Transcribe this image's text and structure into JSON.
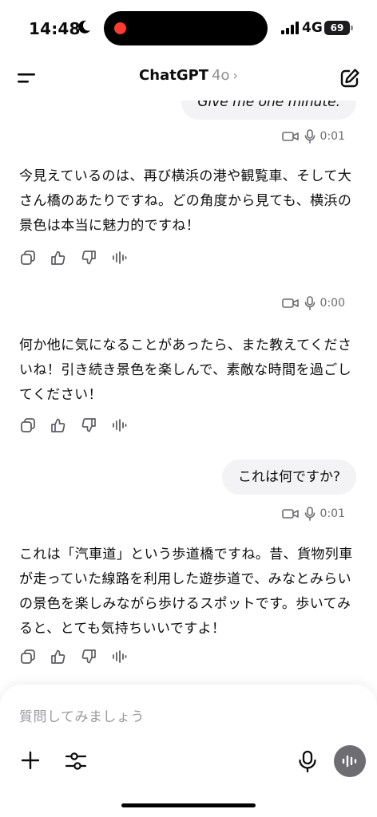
{
  "status_bar": {
    "time": "14:48",
    "network": "4G",
    "battery": "69",
    "icons": [
      "moon-icon",
      "signal-icon"
    ]
  },
  "header": {
    "title": "ChatGPT",
    "model": "4o",
    "icons": [
      "menu-icon",
      "chevron-right-icon",
      "compose-icon"
    ]
  },
  "messages": [
    {
      "role": "user",
      "text": "Give me one minute.",
      "duration": "0:01"
    },
    {
      "role": "assistant",
      "text": "今見えているのは、再び横浜の港や観覧車、そして大さん橋のあたりですね。どの角度から見ても、横浜の景色は本当に魅力的ですね！"
    },
    {
      "role": "user",
      "text": "",
      "duration": "0:00"
    },
    {
      "role": "assistant",
      "text": "何か他に気になることがあったら、また教えてくださいね！引き続き景色を楽しんで、素敵な時間を過ごしてください！"
    },
    {
      "role": "user",
      "text": "これは何ですか?",
      "duration": "0:01"
    },
    {
      "role": "assistant",
      "text": "これは「汽車道」という歩道橋ですね。昔、貨物列車が走っていた線路を利用した遊歩道で、みなとみらいの景色を楽しみながら歩けるスポットです。歩いてみると、とても気持ちいいですよ！"
    }
  ],
  "message_action_icons": [
    "copy-icon",
    "thumbs-up-icon",
    "thumbs-down-icon",
    "read-aloud-icon"
  ],
  "meta_icons": [
    "video-icon",
    "microphone-icon"
  ],
  "composer": {
    "placeholder": "質問してみましょう",
    "icons": [
      "plus-icon",
      "sliders-icon",
      "microphone-icon",
      "voice-mode-icon"
    ]
  },
  "colors": {
    "bubble": "#f3f3f5",
    "meta_text": "#6e6e73",
    "voice_button": "#6d6d72",
    "recording_dot": "#ff3b30"
  }
}
